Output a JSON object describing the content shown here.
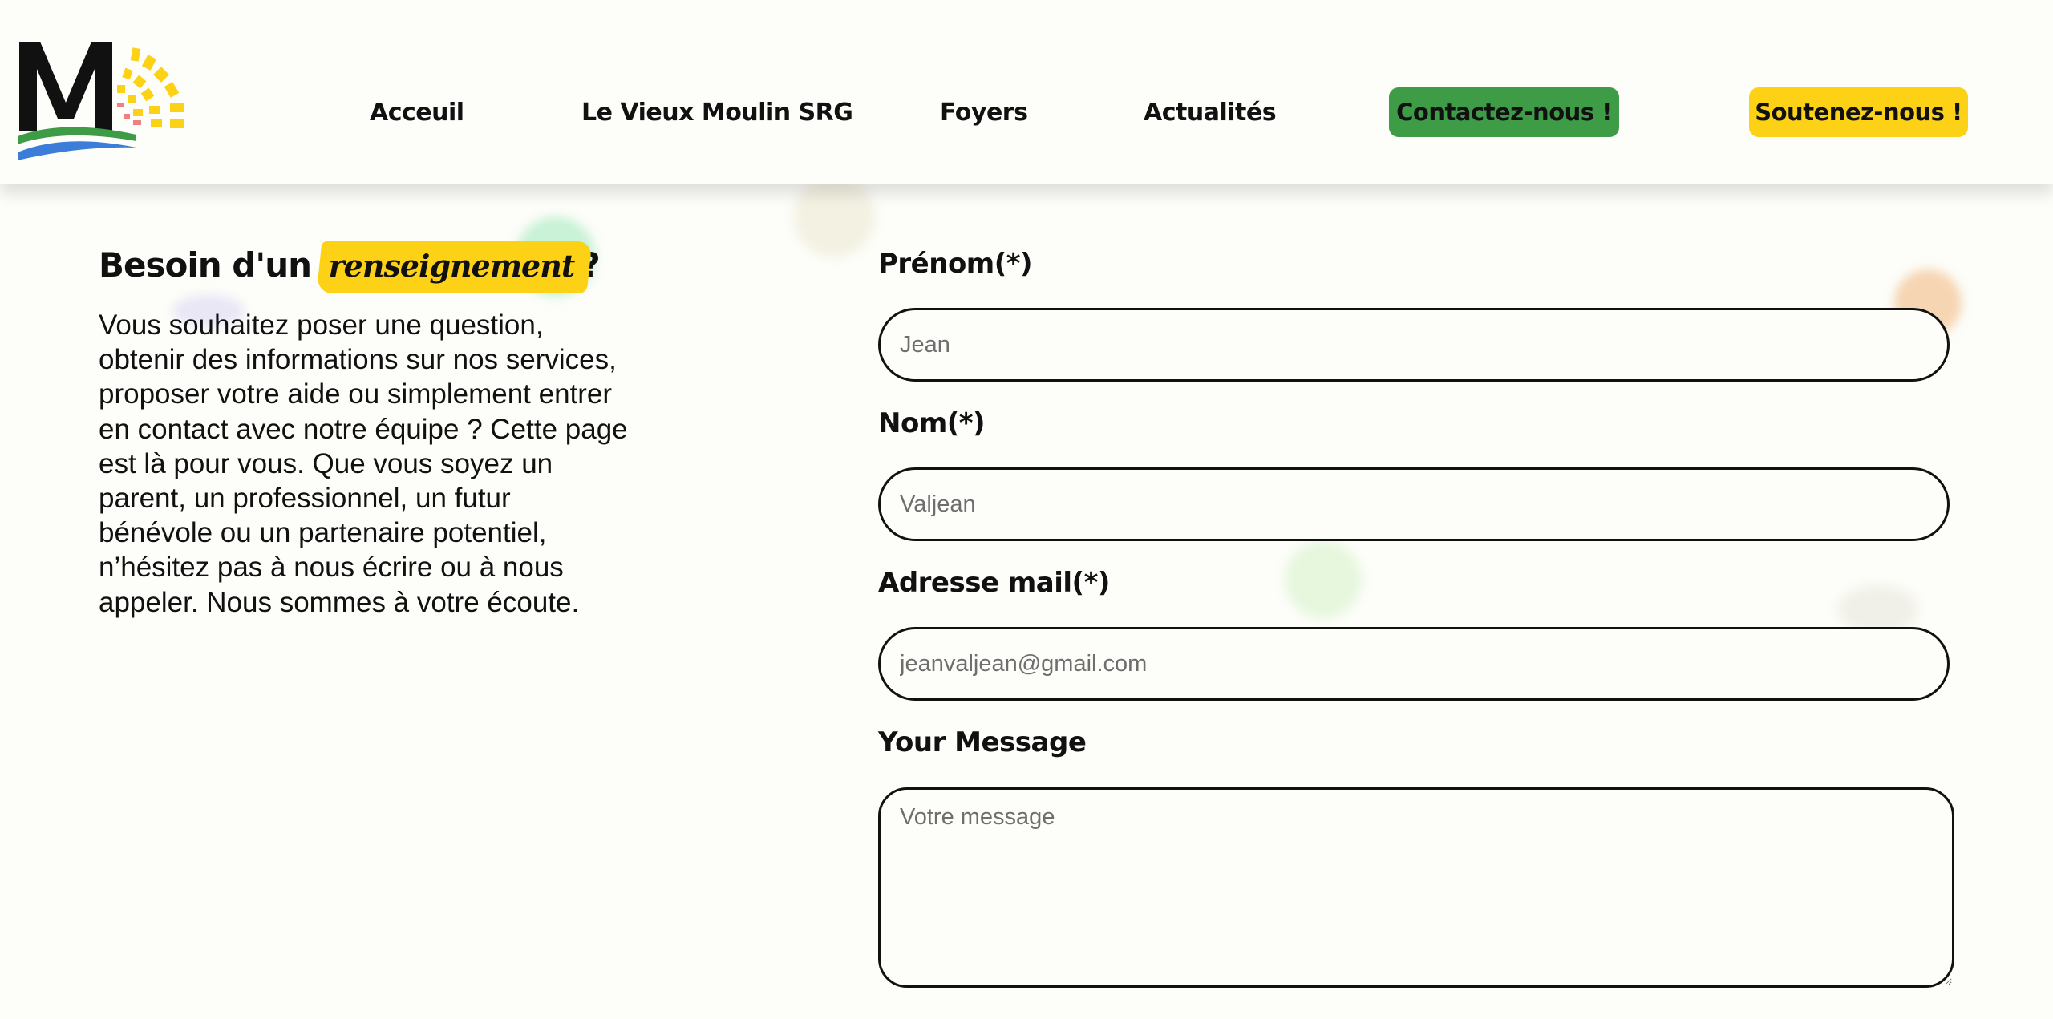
{
  "header": {
    "nav": [
      {
        "label": "Acceuil"
      },
      {
        "label": "Le Vieux Moulin SRG"
      },
      {
        "label": "Foyers"
      },
      {
        "label": "Actualités"
      }
    ],
    "contact_label": "Contactez-nous !",
    "support_label": "Soutenez-nous !"
  },
  "intro": {
    "title_before": "Besoin d'un",
    "title_highlight": "renseignement",
    "title_after": "?",
    "body": "Vous souhaitez poser une question, obtenir des informations sur nos services, proposer votre aide ou simplement entrer en contact avec notre équipe ? Cette page est là pour vous. Que vous soyez un parent, un professionnel, un futur bénévole ou un partenaire potentiel, n’hésitez pas à nous écrire ou à nous appeler. Nous sommes à votre écoute."
  },
  "form": {
    "first_name": {
      "label": "Prénom(*)",
      "placeholder": "Jean",
      "value": ""
    },
    "last_name": {
      "label": "Nom(*)",
      "placeholder": "Valjean",
      "value": ""
    },
    "email": {
      "label": "Adresse mail(*)",
      "placeholder": "jeanvaljean@gmail.com",
      "value": ""
    },
    "message": {
      "label": "Your Message",
      "placeholder": "Votre message",
      "value": ""
    }
  },
  "colors": {
    "green": "#3f9c46",
    "yellow": "#fcd116",
    "background": "#fdfdf9",
    "text": "#111111"
  },
  "icons": {
    "logo": "le-vieux-moulin-logo"
  }
}
